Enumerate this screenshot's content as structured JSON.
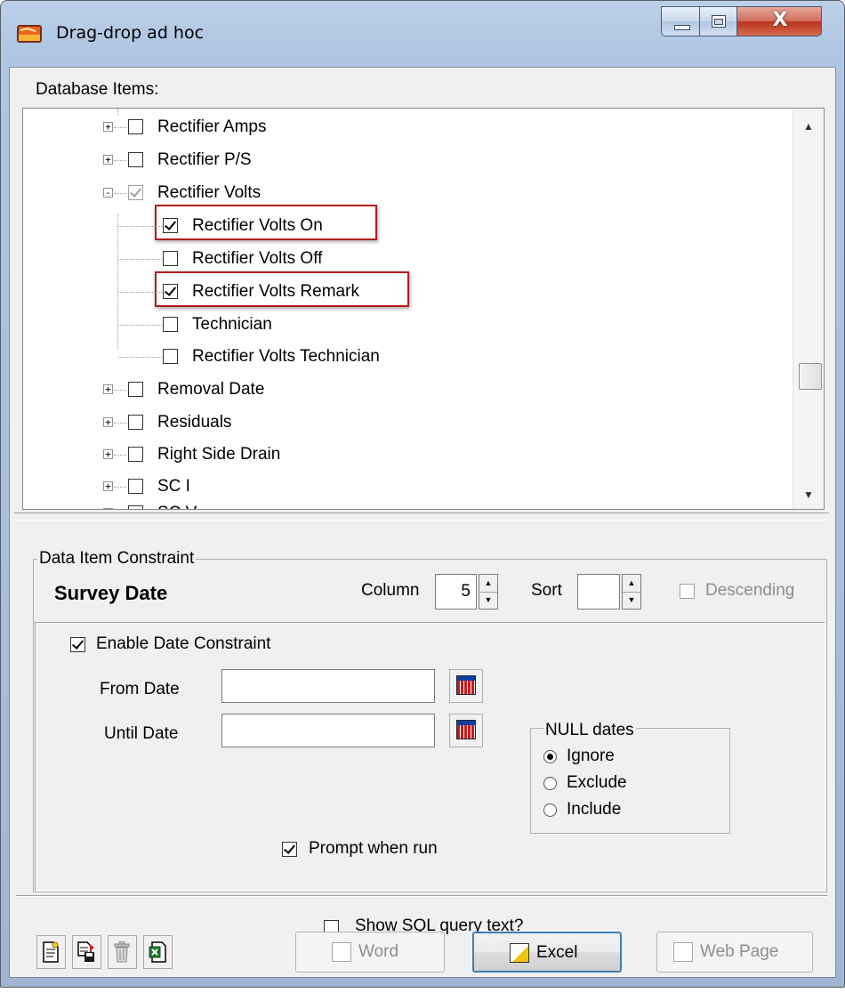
{
  "window": {
    "title": "Drag-drop ad hoc",
    "close_glyph": "X"
  },
  "database_items": {
    "label": "Database Items:",
    "tree": [
      {
        "label": "Rectifier Amps",
        "level": 1,
        "expander": "+",
        "checked": false
      },
      {
        "label": "Rectifier P/S",
        "level": 1,
        "expander": "+",
        "checked": false
      },
      {
        "label": "Rectifier Volts",
        "level": 1,
        "expander": "-",
        "checked": true,
        "greyed": true
      },
      {
        "label": "Rectifier Volts On",
        "level": 2,
        "checked": true,
        "highlighted": true
      },
      {
        "label": "Rectifier Volts Off",
        "level": 2,
        "checked": false
      },
      {
        "label": "Rectifier Volts Remark",
        "level": 2,
        "checked": true,
        "highlighted": true
      },
      {
        "label": "Technician",
        "level": 2,
        "checked": false
      },
      {
        "label": "Rectifier Volts Technician",
        "level": 2,
        "checked": false
      },
      {
        "label": "Removal Date",
        "level": 1,
        "expander": "+",
        "checked": false
      },
      {
        "label": "Residuals",
        "level": 1,
        "expander": "+",
        "checked": false
      },
      {
        "label": "Right Side Drain",
        "level": 1,
        "expander": "+",
        "checked": false
      },
      {
        "label": "SC I",
        "level": 1,
        "expander": "+",
        "checked": false
      },
      {
        "label": "SC V",
        "level": 1,
        "expander": "+",
        "checked": false
      }
    ]
  },
  "constraint": {
    "group_title": "Data Item Constraint",
    "item_name": "Survey Date",
    "column_label": "Column",
    "column_value": "5",
    "sort_label": "Sort",
    "sort_value": "",
    "descending_label": "Descending",
    "descending_checked": false,
    "enable_date_label": "Enable Date Constraint",
    "enable_date_checked": true,
    "from_date_label": "From Date",
    "from_date_value": "",
    "until_date_label": "Until Date",
    "until_date_value": "",
    "null_dates": {
      "title": "NULL dates",
      "options": [
        "Ignore",
        "Exclude",
        "Include"
      ],
      "selected": "Ignore"
    },
    "prompt_label": "Prompt when run",
    "prompt_checked": true
  },
  "footer": {
    "show_sql_label": "Show SQL query text?",
    "show_sql_checked": false,
    "toolbar_icons": [
      "new-query-icon",
      "save-query-icon",
      "delete-icon",
      "excel-export-icon"
    ],
    "buttons": {
      "word": "Word",
      "excel": "Excel",
      "web_page": "Web Page"
    }
  },
  "colors": {
    "highlight_border": "#b41c1c",
    "close_button": "#c7432a",
    "title_gradient": "#aec6e2"
  }
}
